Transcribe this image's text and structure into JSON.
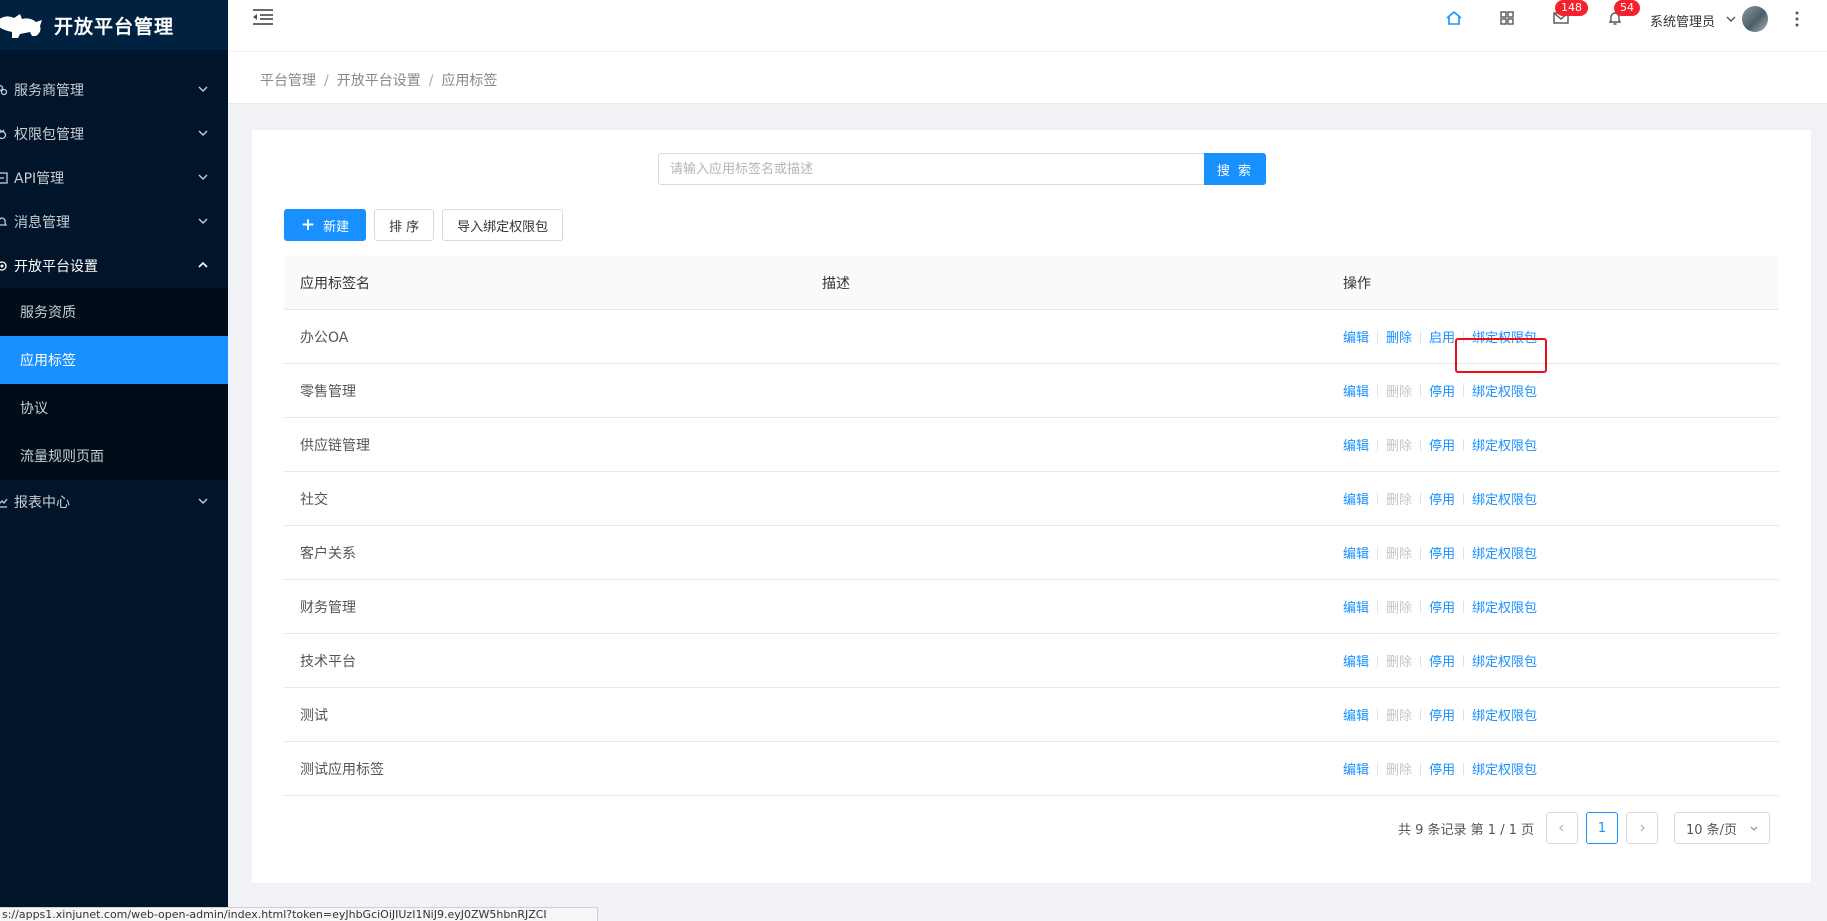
{
  "app": {
    "title": "开放平台管理"
  },
  "sidebar": {
    "items": [
      {
        "label": "服务商管理",
        "icon": "team-icon"
      },
      {
        "label": "权限包管理",
        "icon": "package-icon"
      },
      {
        "label": "API管理",
        "icon": "api-icon"
      },
      {
        "label": "消息管理",
        "icon": "bell-icon"
      },
      {
        "label": "开放平台设置",
        "icon": "settings-icon",
        "open": true,
        "children": [
          {
            "label": "服务资质"
          },
          {
            "label": "应用标签",
            "active": true
          },
          {
            "label": "协议"
          },
          {
            "label": "流量规则页面"
          }
        ]
      },
      {
        "label": "报表中心",
        "icon": "chart-icon"
      }
    ]
  },
  "header": {
    "mail_count": "148",
    "notice_count": "54",
    "user_name": "系统管理员"
  },
  "breadcrumb": [
    "平台管理",
    "开放平台设置",
    "应用标签"
  ],
  "search": {
    "placeholder": "请输入应用标签名或描述",
    "button": "搜 索"
  },
  "toolbar": {
    "new": "新建",
    "sort": "排 序",
    "import": "导入绑定权限包"
  },
  "table": {
    "columns": [
      "应用标签名",
      "描述",
      "操作"
    ],
    "rows": [
      {
        "name": "办公OA",
        "desc": "",
        "edit": "编辑",
        "delete": "删除",
        "toggle": "启用",
        "bind": "绑定权限包",
        "delete_enabled": true
      },
      {
        "name": "零售管理",
        "desc": "",
        "edit": "编辑",
        "delete": "删除",
        "toggle": "停用",
        "bind": "绑定权限包",
        "delete_enabled": false
      },
      {
        "name": "供应链管理",
        "desc": "",
        "edit": "编辑",
        "delete": "删除",
        "toggle": "停用",
        "bind": "绑定权限包",
        "delete_enabled": false
      },
      {
        "name": "社交",
        "desc": "",
        "edit": "编辑",
        "delete": "删除",
        "toggle": "停用",
        "bind": "绑定权限包",
        "delete_enabled": false
      },
      {
        "name": "客户关系",
        "desc": "",
        "edit": "编辑",
        "delete": "删除",
        "toggle": "停用",
        "bind": "绑定权限包",
        "delete_enabled": false
      },
      {
        "name": "财务管理",
        "desc": "",
        "edit": "编辑",
        "delete": "删除",
        "toggle": "停用",
        "bind": "绑定权限包",
        "delete_enabled": false
      },
      {
        "name": "技术平台",
        "desc": "",
        "edit": "编辑",
        "delete": "删除",
        "toggle": "停用",
        "bind": "绑定权限包",
        "delete_enabled": false
      },
      {
        "name": "测试",
        "desc": "",
        "edit": "编辑",
        "delete": "删除",
        "toggle": "停用",
        "bind": "绑定权限包",
        "delete_enabled": false
      },
      {
        "name": "测试应用标签",
        "desc": "",
        "edit": "编辑",
        "delete": "删除",
        "toggle": "停用",
        "bind": "绑定权限包",
        "delete_enabled": false
      }
    ]
  },
  "pagination": {
    "summary": "共 9 条记录 第 1 / 1 页",
    "current": "1",
    "page_size": "10 条/页"
  },
  "statusbar": {
    "url": "s://apps1.xinjunet.com/web-open-admin/index.html?token=eyJhbGciOiJIUzI1NiJ9.eyJ0ZW5hbnRJZCI"
  },
  "colors": {
    "sidebar": "#001529",
    "primary": "#1890ff",
    "highlight": "#e8111b",
    "badge": "#f5222d"
  }
}
